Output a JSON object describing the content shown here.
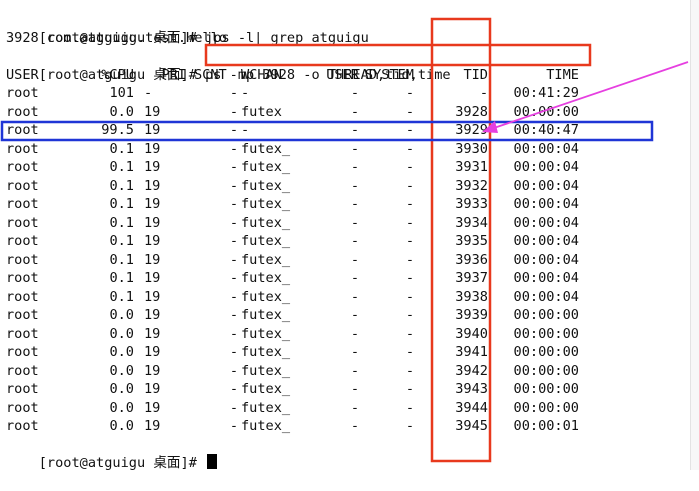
{
  "terminal": {
    "cmd1": {
      "prompt": "[root@atguigu 桌面]#",
      "command": "jps -l| grep atguigu"
    },
    "output1": "3928 com.atguigu.test.Hello",
    "cmd2": {
      "prompt": "[root@atguigu 桌面]#",
      "command": "ps -mp 3928 -o THREAD,tid,time"
    },
    "headers": [
      "USER",
      "%CPU",
      "PRI",
      "SCNT",
      "WCHAN",
      "USER",
      "SYSTEM",
      "TID",
      "TIME"
    ],
    "rows": [
      [
        "root",
        "101",
        "-",
        "-",
        "-",
        "-",
        "-",
        "-",
        "00:41:29"
      ],
      [
        "root",
        "0.0",
        "19",
        "-",
        "futex",
        "-",
        "-",
        "3928",
        "00:00:00"
      ],
      [
        "root",
        "99.5",
        "19",
        "-",
        "-",
        "-",
        "-",
        "3929",
        "00:40:47"
      ],
      [
        "root",
        "0.1",
        "19",
        "-",
        "futex_",
        "-",
        "-",
        "3930",
        "00:00:04"
      ],
      [
        "root",
        "0.1",
        "19",
        "-",
        "futex_",
        "-",
        "-",
        "3931",
        "00:00:04"
      ],
      [
        "root",
        "0.1",
        "19",
        "-",
        "futex_",
        "-",
        "-",
        "3932",
        "00:00:04"
      ],
      [
        "root",
        "0.1",
        "19",
        "-",
        "futex_",
        "-",
        "-",
        "3933",
        "00:00:04"
      ],
      [
        "root",
        "0.1",
        "19",
        "-",
        "futex_",
        "-",
        "-",
        "3934",
        "00:00:04"
      ],
      [
        "root",
        "0.1",
        "19",
        "-",
        "futex_",
        "-",
        "-",
        "3935",
        "00:00:04"
      ],
      [
        "root",
        "0.1",
        "19",
        "-",
        "futex_",
        "-",
        "-",
        "3936",
        "00:00:04"
      ],
      [
        "root",
        "0.1",
        "19",
        "-",
        "futex_",
        "-",
        "-",
        "3937",
        "00:00:04"
      ],
      [
        "root",
        "0.1",
        "19",
        "-",
        "futex_",
        "-",
        "-",
        "3938",
        "00:00:04"
      ],
      [
        "root",
        "0.0",
        "19",
        "-",
        "futex_",
        "-",
        "-",
        "3939",
        "00:00:00"
      ],
      [
        "root",
        "0.0",
        "19",
        "-",
        "futex_",
        "-",
        "-",
        "3940",
        "00:00:00"
      ],
      [
        "root",
        "0.0",
        "19",
        "-",
        "futex_",
        "-",
        "-",
        "3941",
        "00:00:00"
      ],
      [
        "root",
        "0.0",
        "19",
        "-",
        "futex_",
        "-",
        "-",
        "3942",
        "00:00:00"
      ],
      [
        "root",
        "0.0",
        "19",
        "-",
        "futex_",
        "-",
        "-",
        "3943",
        "00:00:00"
      ],
      [
        "root",
        "0.0",
        "19",
        "-",
        "futex_",
        "-",
        "-",
        "3944",
        "00:00:00"
      ],
      [
        "root",
        "0.0",
        "19",
        "-",
        "futex_",
        "-",
        "-",
        "3945",
        "00:00:01"
      ]
    ],
    "final_prompt": "[root@atguigu 桌面]#"
  },
  "annotations": {
    "highlight_colors": {
      "command_box": "#e8391d",
      "tid_column_box": "#e8391d",
      "row_box": "#1f35d6",
      "arrow": "#e63fe0"
    }
  }
}
